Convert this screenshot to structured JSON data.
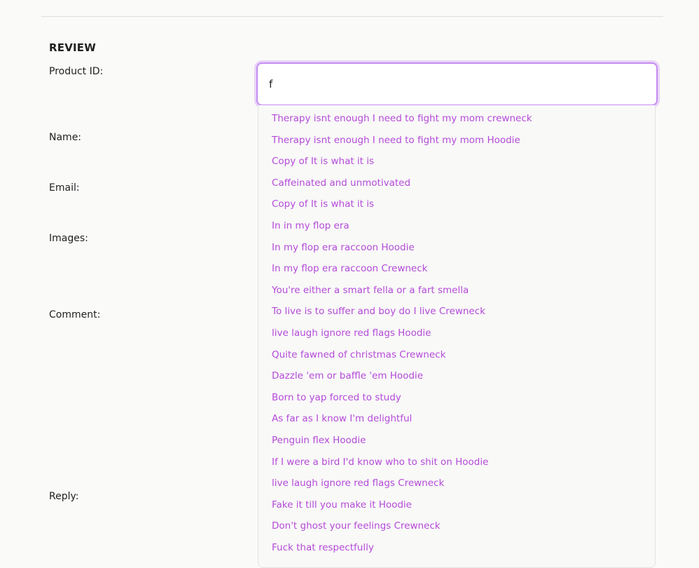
{
  "section_title": "REVIEW",
  "labels": {
    "product_id": "Product ID:",
    "name": "Name:",
    "email": "Email:",
    "images": "Images:",
    "comment": "Comment:",
    "reply": "Reply:"
  },
  "product_input": {
    "value": "f"
  },
  "suggestions": [
    "Therapy isnt enough I need to fight my mom crewneck",
    "Therapy isnt enough I need to fight my mom Hoodie",
    "Copy of It is what it is",
    "Caffeinated and unmotivated",
    "Copy of It is what it is",
    "In in my flop era",
    "In my flop era raccoon Hoodie",
    "In my flop era raccoon Crewneck",
    "You're either a smart fella or a fart smella",
    "To live is to suffer and boy do I live Crewneck",
    "live laugh ignore red flags Hoodie",
    "Quite fawned of christmas Crewneck",
    "Dazzle 'em or baffle 'em Hoodie",
    "Born to yap forced to study",
    "As far as I know I'm delightful",
    "Penguin flex Hoodie",
    "If I were a bird I'd know who to shit on Hoodie",
    "live laugh ignore red flags Crewneck",
    "Fake it till you make it Hoodie",
    "Don't ghost your feelings Crewneck",
    "Fuck that respectfully"
  ],
  "colors": {
    "accent": "#c58cf2",
    "suggestion_text": "#b44ad8",
    "background": "#fafaf9"
  }
}
